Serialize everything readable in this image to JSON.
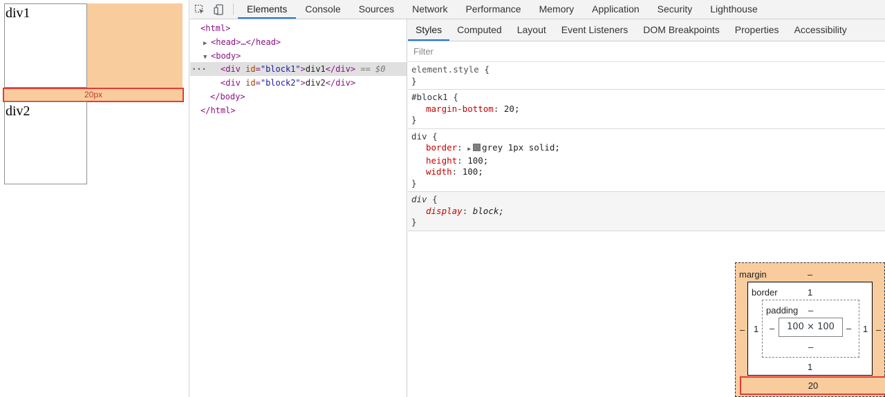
{
  "preview": {
    "block1_text": "div1",
    "block2_text": "div2",
    "gap_label": "20px"
  },
  "toolbar": {
    "tabs": [
      "Elements",
      "Console",
      "Sources",
      "Network",
      "Performance",
      "Memory",
      "Application",
      "Security",
      "Lighthouse"
    ],
    "active_tab": "Elements"
  },
  "dom_tree": {
    "html_open": "<html>",
    "head": "<head>…</head>",
    "body_open": "<body>",
    "div1_tag": "div",
    "div1_attr_name": "id",
    "div1_attr_value": "\"block1\"",
    "div1_text": "div1",
    "div1_suffix": "== $0",
    "div2_tag": "div",
    "div2_attr_name": "id",
    "div2_attr_value": "\"block2\"",
    "div2_text": "div2",
    "body_close": "</body>",
    "html_close": "</html>"
  },
  "styles": {
    "subtabs": [
      "Styles",
      "Computed",
      "Layout",
      "Event Listeners",
      "DOM Breakpoints",
      "Properties",
      "Accessibility"
    ],
    "active_subtab": "Styles",
    "filter_placeholder": "Filter",
    "rules": {
      "element_style": {
        "selector": "element.style"
      },
      "block1": {
        "selector": "#block1",
        "prop": "margin-bottom",
        "value": "20;"
      },
      "div": {
        "selector": "div",
        "border_prop": "border",
        "border_value": "grey 1px solid;",
        "height_prop": "height",
        "height_value": "100;",
        "width_prop": "width",
        "width_value": "100;"
      },
      "ua_div": {
        "selector": "div",
        "prop": "display",
        "value": "block;"
      }
    }
  },
  "box_model": {
    "margin_label": "margin",
    "margin_top": "–",
    "margin_left": "–",
    "margin_right": "–",
    "margin_bottom": "20",
    "border_label": "border",
    "border_top": "1",
    "border_left": "1",
    "border_right": "1",
    "border_bottom": "1",
    "padding_label": "padding",
    "padding_top": "–",
    "padding_left": "–",
    "padding_right": "–",
    "padding_bottom": "–",
    "content": "100 × 100"
  },
  "colors": {
    "margin_highlight": "#f9cc9d",
    "annotation_red": "#e53935",
    "active_tab_underline": "#1a73e8"
  }
}
